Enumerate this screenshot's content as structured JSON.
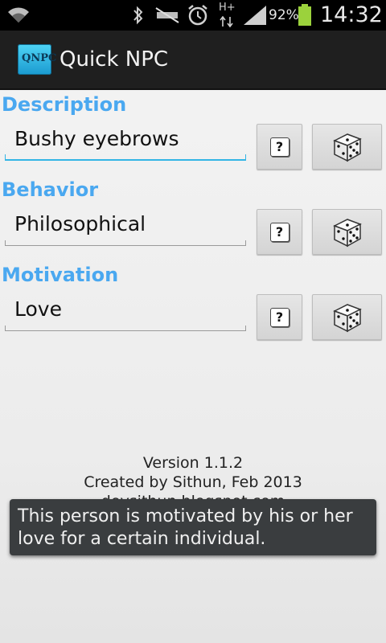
{
  "status_bar": {
    "battery_percent": "92%",
    "time": "14:32",
    "network_label": "H+",
    "icons": [
      "wifi-icon",
      "bluetooth-icon",
      "mute-icon",
      "alarm-icon",
      "data-transfer-icon",
      "signal-icon",
      "battery-icon"
    ]
  },
  "action_bar": {
    "app_icon_text": "QNPC",
    "title": "Quick NPC"
  },
  "sections": [
    {
      "label": "Description",
      "value": "Bushy eyebrows"
    },
    {
      "label": "Behavior",
      "value": "Philosophical"
    },
    {
      "label": "Motivation",
      "value": "Love"
    }
  ],
  "buttons": {
    "help_symbol": "?",
    "help_icon": "question-icon",
    "random_icon": "dice-icon"
  },
  "footer": {
    "version": "Version 1.1.2",
    "credit": "Created by Sithun, Feb 2013",
    "website": "devsithun.blogspot.com"
  },
  "toast": {
    "message": "This person is motivated by his or her love for a certain individual."
  },
  "colors": {
    "accent": "#4aa8f0",
    "focus_line": "#33b5e5",
    "toast_bg": "#3a3d3f"
  }
}
